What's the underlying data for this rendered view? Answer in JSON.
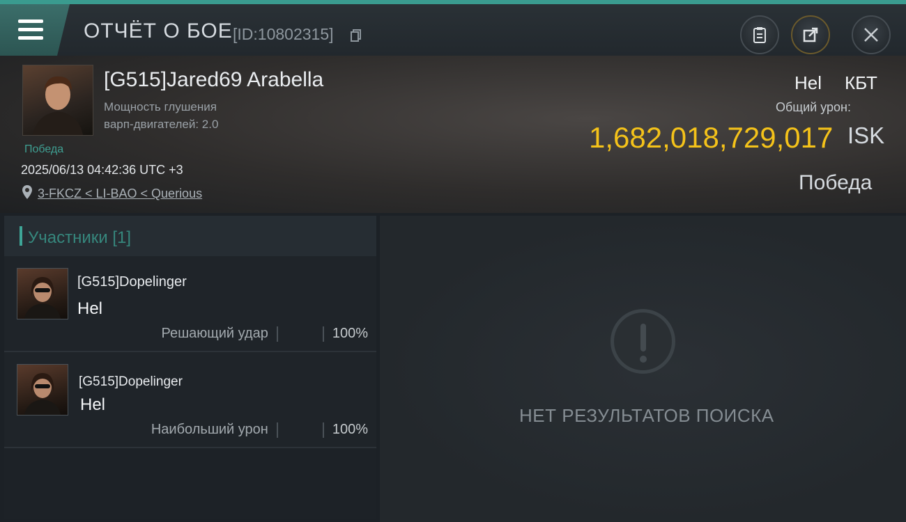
{
  "header": {
    "title": "ОТЧЁТ О БОЕ",
    "id_label": "[ID:10802315]",
    "icons": [
      "menu-icon",
      "copy-icon",
      "clipboard-icon",
      "share-icon",
      "close-icon"
    ],
    "accent": "#3a9b8f"
  },
  "report": {
    "pilot_name": "[G515]Jared69 Arabella",
    "warp_line1": "Мощность глушения",
    "warp_line2": "варп-двигателей: 2.0",
    "victory_tag": "Победа",
    "timestamp": "2025/06/13 04:42:36 UTC +3",
    "location": "3-FKCZ < LI-BAO < Querious",
    "ship_name": "Hel",
    "ship_class": "КБТ",
    "damage_label": "Общий урон:",
    "damage_value": "1,682,018,729,017",
    "currency": "ISK",
    "result": "Победа",
    "damage_color": "#f4c21a"
  },
  "participants": {
    "heading": "Участники [1]",
    "rows": [
      {
        "name": "[G515]Dopelinger",
        "ship": "Hel",
        "role": "Решающий удар",
        "percent": "100%"
      },
      {
        "name": "[G515]Dopelinger",
        "ship": "Hel",
        "role": "Наибольший урон",
        "percent": "100%"
      }
    ]
  },
  "empty_state": {
    "message": "НЕТ РЕЗУЛЬТАТОВ ПОИСКА",
    "icon": "alert-icon"
  }
}
